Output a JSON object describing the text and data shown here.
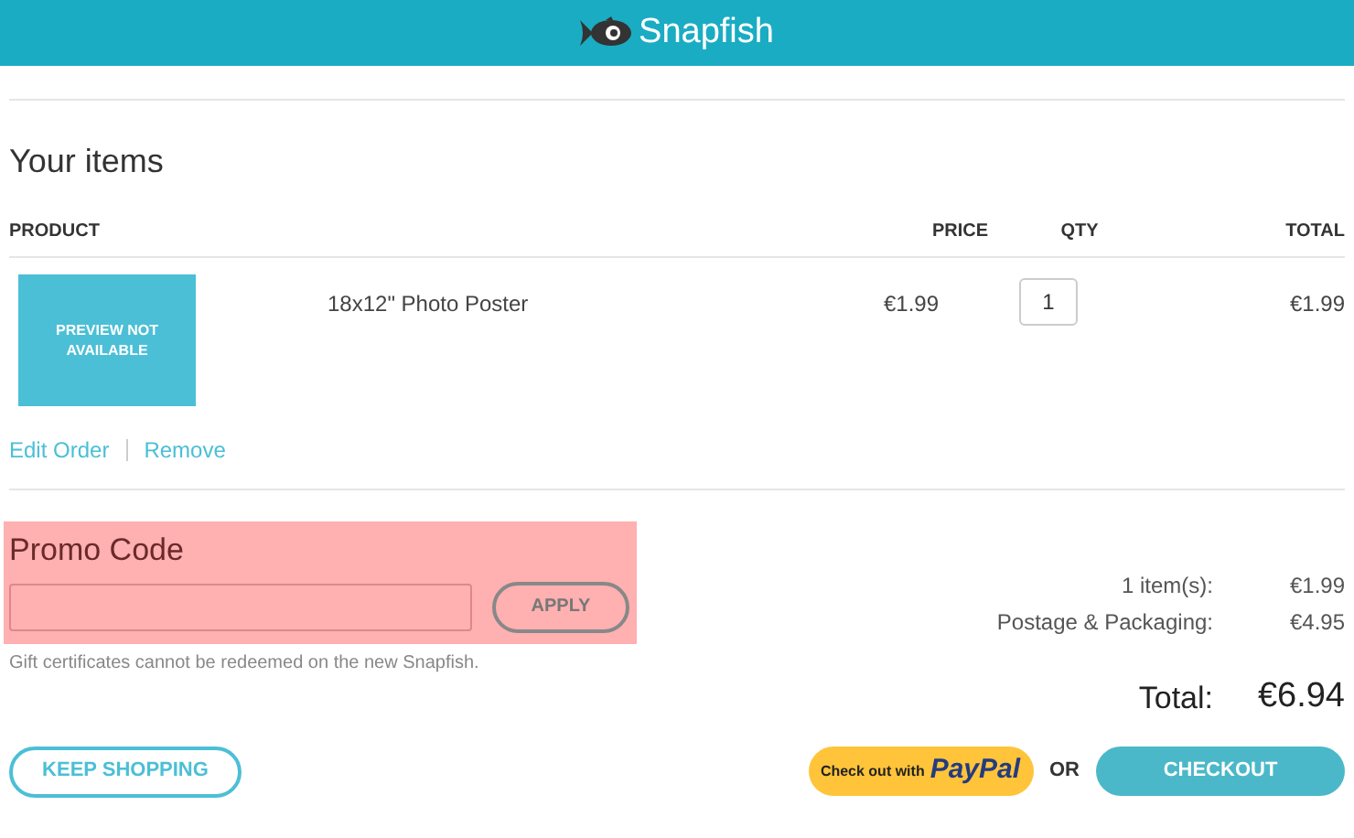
{
  "header": {
    "brand": "Snapfish"
  },
  "items_title": "Your items",
  "table": {
    "columns": [
      "PRODUCT",
      "PRICE",
      "QTY",
      "TOTAL"
    ],
    "rows": [
      {
        "preview": "PREVIEW NOT AVAILABLE",
        "name": "18x12\" Photo Poster",
        "price": "€1.99",
        "qty": "1",
        "total": "€1.99",
        "actions": [
          "Edit Order",
          "Remove"
        ]
      }
    ]
  },
  "promo": {
    "title": "Promo Code",
    "highlighted": true,
    "button": "APPLY",
    "note": "Gift certificates cannot be redeemed on the new Snapfish."
  },
  "summary": {
    "lines": [
      {
        "label": "1 item(s):",
        "value": "€1.99"
      },
      {
        "label": "Postage & Packaging:",
        "value": "€4.95"
      }
    ],
    "total_label": "Total:",
    "total_value": "€6.94"
  },
  "buttons": {
    "keep_shopping": "KEEP SHOPPING",
    "paypal_prefix": "Check out with",
    "paypal_brand": "PayPal",
    "or": "OR",
    "checkout": "CHECKOUT"
  }
}
